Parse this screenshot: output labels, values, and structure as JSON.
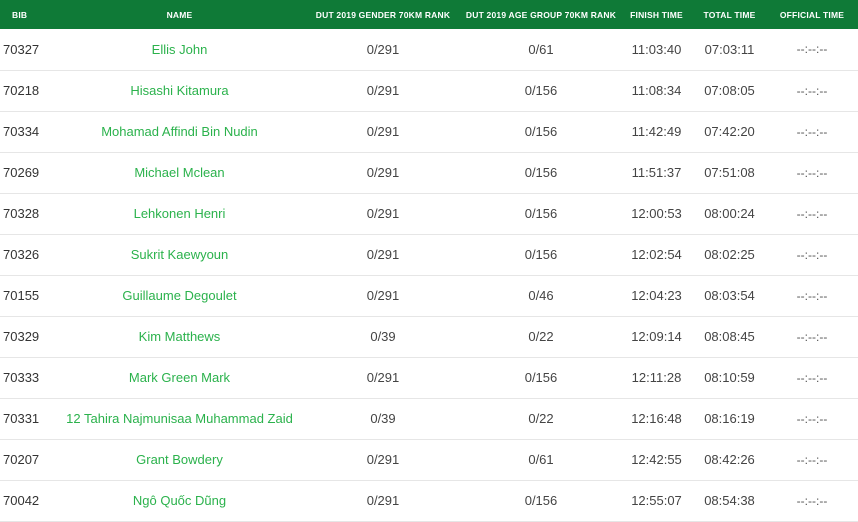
{
  "colors": {
    "header_bg": "#0f7a37",
    "name_link": "#2bb24c"
  },
  "headers": {
    "bib": "BIB",
    "name": "NAME",
    "gender_rank": "DUT 2019 GENDER 70KM RANK",
    "age_rank": "DUT 2019 AGE GROUP 70KM RANK",
    "finish_time": "FINISH TIME",
    "total_time": "TOTAL TIME",
    "official_time": "OFFICIAL TIME"
  },
  "rows": [
    {
      "bib": "70327",
      "name": "Ellis John",
      "gender_rank": "0/291",
      "age_rank": "0/61",
      "finish_time": "11:03:40",
      "total_time": "07:03:11",
      "official_time": "--:--:--"
    },
    {
      "bib": "70218",
      "name": "Hisashi Kitamura",
      "gender_rank": "0/291",
      "age_rank": "0/156",
      "finish_time": "11:08:34",
      "total_time": "07:08:05",
      "official_time": "--:--:--"
    },
    {
      "bib": "70334",
      "name": "Mohamad Affindi Bin Nudin",
      "gender_rank": "0/291",
      "age_rank": "0/156",
      "finish_time": "11:42:49",
      "total_time": "07:42:20",
      "official_time": "--:--:--"
    },
    {
      "bib": "70269",
      "name": "Michael Mclean",
      "gender_rank": "0/291",
      "age_rank": "0/156",
      "finish_time": "11:51:37",
      "total_time": "07:51:08",
      "official_time": "--:--:--"
    },
    {
      "bib": "70328",
      "name": "Lehkonen Henri",
      "gender_rank": "0/291",
      "age_rank": "0/156",
      "finish_time": "12:00:53",
      "total_time": "08:00:24",
      "official_time": "--:--:--"
    },
    {
      "bib": "70326",
      "name": "Sukrit Kaewyoun",
      "gender_rank": "0/291",
      "age_rank": "0/156",
      "finish_time": "12:02:54",
      "total_time": "08:02:25",
      "official_time": "--:--:--"
    },
    {
      "bib": "70155",
      "name": "Guillaume Degoulet",
      "gender_rank": "0/291",
      "age_rank": "0/46",
      "finish_time": "12:04:23",
      "total_time": "08:03:54",
      "official_time": "--:--:--"
    },
    {
      "bib": "70329",
      "name": "Kim Matthews",
      "gender_rank": "0/39",
      "age_rank": "0/22",
      "finish_time": "12:09:14",
      "total_time": "08:08:45",
      "official_time": "--:--:--"
    },
    {
      "bib": "70333",
      "name": "Mark Green Mark",
      "gender_rank": "0/291",
      "age_rank": "0/156",
      "finish_time": "12:11:28",
      "total_time": "08:10:59",
      "official_time": "--:--:--"
    },
    {
      "bib": "70331",
      "name": "12 Tahira  Najmunisaa Muhammad Zaid",
      "gender_rank": "0/39",
      "age_rank": "0/22",
      "finish_time": "12:16:48",
      "total_time": "08:16:19",
      "official_time": "--:--:--"
    },
    {
      "bib": "70207",
      "name": "Grant Bowdery",
      "gender_rank": "0/291",
      "age_rank": "0/61",
      "finish_time": "12:42:55",
      "total_time": "08:42:26",
      "official_time": "--:--:--"
    },
    {
      "bib": "70042",
      "name": "Ngô Quốc Dũng",
      "gender_rank": "0/291",
      "age_rank": "0/156",
      "finish_time": "12:55:07",
      "total_time": "08:54:38",
      "official_time": "--:--:--"
    }
  ]
}
